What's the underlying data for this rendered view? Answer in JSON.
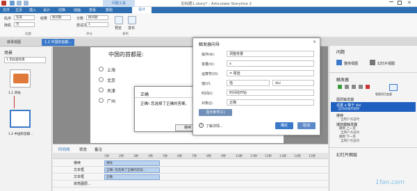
{
  "app": {
    "title": "无标题1.story* - Articulate Storyline 2",
    "context_tab": "问题工具"
  },
  "menu_tabs": [
    "文件",
    "主页",
    "插入",
    "设计",
    "切换",
    "动画",
    "查看",
    "帮助",
    "设计"
  ],
  "ribbon": {
    "shuffle_label": "乱序",
    "shuffle_value": "答案",
    "random_label": "随机",
    "random_value": "无",
    "feedback_label": "结果",
    "feedback_value": "按问题",
    "score_label": "分数",
    "score_value": "按问题",
    "attempts_label": "尝试次数",
    "attempts_value": "1",
    "group_question": "问题",
    "group_score": "评分",
    "group_publish": "发布",
    "preview_label": "预览",
    "publish_label": "发布"
  },
  "slide_tabs": {
    "story_view": "故事视图",
    "current": "1.2 中国的首都..."
  },
  "left_panel": {
    "title": "场景",
    "scene_select": "1 无标题场景",
    "thumb1": "1.1 开始",
    "thumb2": "1.2 中国的首都..."
  },
  "slide": {
    "question": "中国的首都是:",
    "options": [
      "上海",
      "北京",
      "天津",
      "广州"
    ]
  },
  "popup": {
    "title": "正确",
    "body": "正确! 您选择了正确的答案。",
    "button": "继续"
  },
  "dialog": {
    "title": "触发器向导",
    "action_label": "操作(A):",
    "action_value": "调整变量",
    "variable_label": "变量(V):",
    "variable_value": "x",
    "operator_label": "运算符(O):",
    "operator_value": "= 赋值",
    "value_label": "值(V):",
    "value_value": "值",
    "value_num": "dui",
    "when_label": "时间(I):",
    "when_value": "时间线开始",
    "object_label": "对象(J):",
    "object_value": "正确",
    "conditions_label": "显示条件(C)",
    "learn_more": "了解详情...",
    "ok": "确定",
    "cancel": "取消"
  },
  "right_panel": {
    "questions_title": "问题",
    "form_view": "整体视图",
    "slide_view": "幻灯片视图",
    "triggers_title": "触发器",
    "manage_label": "管理项目变量",
    "slide_triggers": "图层触发器",
    "trigger_selected": "设置 x 等于 dui",
    "trigger_selected_sub": "当时间线开始时",
    "continue_label": "继续",
    "continue_sub": "当用户点击时",
    "player_triggers": "播放器触发器",
    "player_a": "跳到 上一页",
    "player_a_sub": "当用户点击时",
    "player_b": "跳到 下一页",
    "player_b_sub": "当用户点击时",
    "layers_title": "幻灯片图层"
  },
  "timeline": {
    "tabs": [
      "时间线",
      "状态",
      "备注"
    ],
    "ruler": [
      "1秒",
      "2秒",
      "3秒",
      "4秒",
      "5秒",
      "6秒",
      "7秒",
      "8秒",
      "9秒",
      "10秒",
      "11秒",
      "12秒",
      "13秒",
      "14秒",
      "15秒"
    ],
    "rows": [
      {
        "name": "继续",
        "bar": "继续"
      },
      {
        "name": "文本框",
        "bar": "正确! 您选择了正确的答案..."
      },
      {
        "name": "文本框",
        "bar": "正确"
      },
      {
        "name": "高亮图层...",
        "bar": ""
      }
    ]
  },
  "watermark": "1fan.com",
  "colors": {
    "accent": "#2e6fb3",
    "selection": "#1f5fbf"
  }
}
